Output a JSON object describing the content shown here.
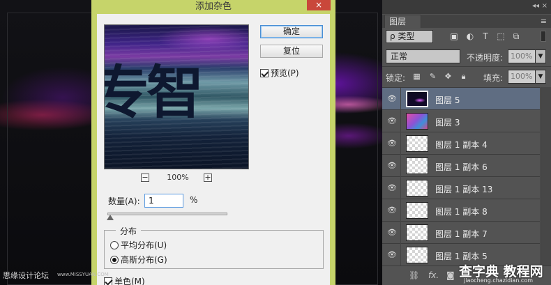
{
  "dialog": {
    "title": "添加杂色",
    "close_icon": "×",
    "preview_text": "专智",
    "zoom_level": "100%",
    "zoom_out": "−",
    "zoom_in": "+",
    "ok_label": "确定",
    "reset_label": "复位",
    "preview_label": "预览(P)",
    "preview_checked": true,
    "amount_label": "数量(A):",
    "amount_value": "1",
    "amount_unit": "%",
    "distribution_label": "分布",
    "uniform_label": "平均分布(U)",
    "gaussian_label": "高斯分布(G)",
    "distribution_selected": "gaussian",
    "monochromatic_label": "单色(M)",
    "monochromatic_checked": true
  },
  "layers_panel": {
    "collapse_icon": "◂◂",
    "close_icon": "×",
    "tab_label": "图层",
    "menu_icon": "≡",
    "filter_label": "ρ 类型",
    "blend_mode": "正常",
    "opacity_label": "不透明度:",
    "opacity_value": "100%",
    "lock_label": "锁定:",
    "fill_label": "填充:",
    "fill_value": "100%",
    "layers": [
      {
        "name": "图层 5",
        "thumb": "dark",
        "selected": true
      },
      {
        "name": "图层 3",
        "thumb": "color",
        "selected": false
      },
      {
        "name": "图层 1 副本 4",
        "thumb": "transparent",
        "selected": false
      },
      {
        "name": "图层 1 副本 6",
        "thumb": "transparent",
        "selected": false
      },
      {
        "name": "图层 1 副本 13",
        "thumb": "transparent",
        "selected": false
      },
      {
        "name": "图层 1 副本 8",
        "thumb": "transparent",
        "selected": false
      },
      {
        "name": "图层 1 副本 7",
        "thumb": "transparent",
        "selected": false
      },
      {
        "name": "图层 1 副本 5",
        "thumb": "transparent",
        "selected": false
      }
    ],
    "bottom_fx": "fx."
  },
  "watermarks": {
    "left_text": "思缘设计论坛",
    "left_url": "www.MISSYUAN.COM",
    "right_text": "查字典 教程网",
    "right_url": "jiaocheng.chazidian.com"
  },
  "colors": {
    "dialog_frame": "#c6d46a",
    "close_button": "#c9473a",
    "selected_layer": "#5f6d82",
    "panel_bg": "#535353"
  }
}
